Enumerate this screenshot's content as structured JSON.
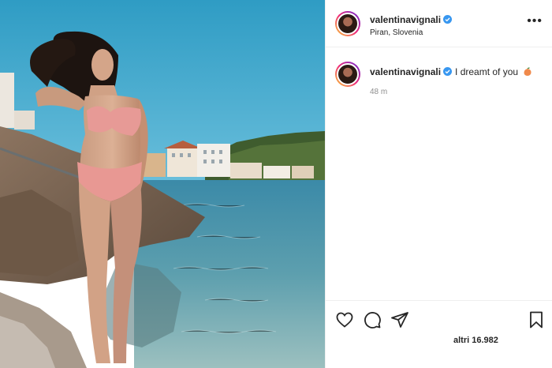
{
  "post": {
    "username": "valentinavignali",
    "location": "Piran, Slovenia",
    "caption_text": "I dreamt of you",
    "caption_emoji": "peach-emoji",
    "time_ago": "48 m",
    "likes_text": "altri 16.982"
  },
  "icons": {
    "verified": "verified-badge-icon",
    "more": "more-options-icon",
    "like": "heart-icon",
    "comment": "comment-bubble-icon",
    "share": "paper-plane-icon",
    "save": "bookmark-icon"
  },
  "colors": {
    "verified_blue": "#3897f0",
    "text": "#262626",
    "muted": "#8e8e8e",
    "divider": "#efefef"
  }
}
